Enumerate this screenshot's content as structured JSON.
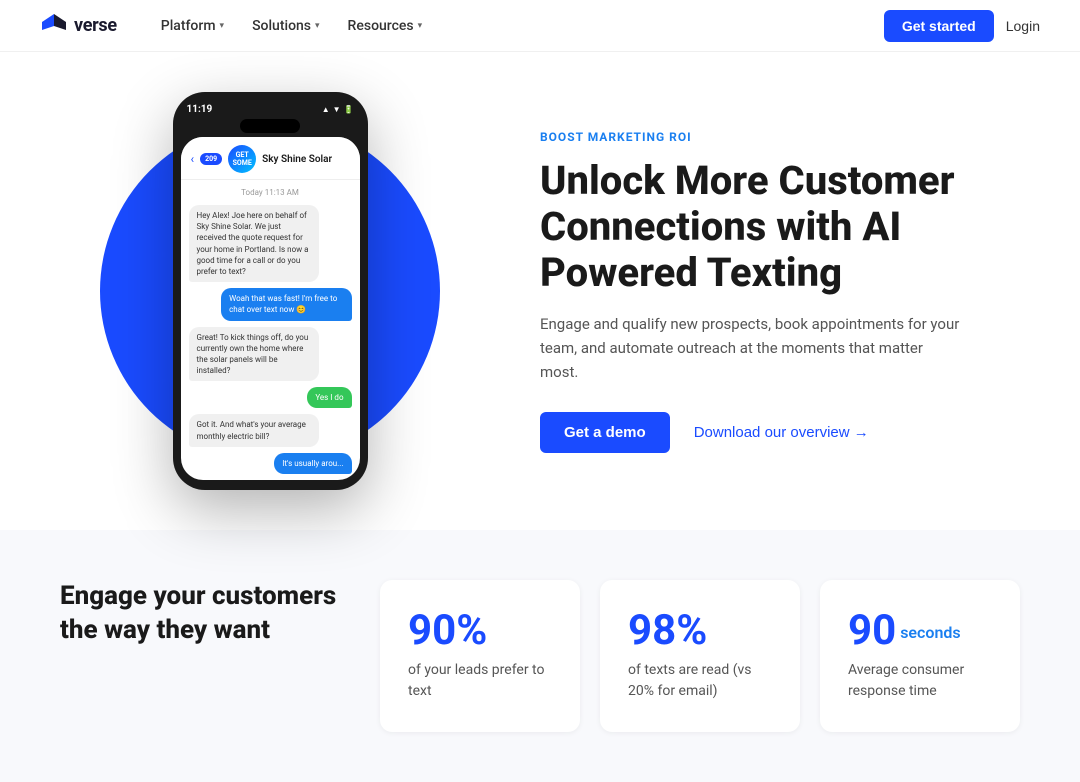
{
  "nav": {
    "logo_text": "verse",
    "items": [
      {
        "label": "Platform",
        "has_dropdown": true
      },
      {
        "label": "Solutions",
        "has_dropdown": true
      },
      {
        "label": "Resources",
        "has_dropdown": true
      }
    ],
    "cta_label": "Get started",
    "login_label": "Login"
  },
  "hero": {
    "phone": {
      "time": "11:19",
      "status": "▲ ▼ 🔋",
      "chat_back": "‹",
      "chat_badge": "209",
      "chat_name": "Sky Shine Solar",
      "date_label": "Today 11:13 AM",
      "messages": [
        {
          "type": "left",
          "text": "Hey Alex! Joe here on behalf of Sky Shine Solar. We just received the quote request for your home in Portland. Is now a good time for a call or do you prefer to text?"
        },
        {
          "type": "right-blue",
          "text": "Woah that was fast! I'm free to chat over text now 😊"
        },
        {
          "type": "left",
          "text": "Great! To kick things off, do you currently own the home where the solar panels will be installed?"
        },
        {
          "type": "right-green",
          "text": "Yes I do"
        },
        {
          "type": "left",
          "text": "Got it. And what's your average monthly electric bill?"
        },
        {
          "type": "right-blue",
          "text": "It's usually arou..."
        }
      ]
    },
    "label": "BOOST MARKETING ROI",
    "title": "Unlock More Customer Connections with AI Powered Texting",
    "description": "Engage and qualify new prospects, book appointments for your team, and automate outreach at the moments that matter most.",
    "cta_primary": "Get a demo",
    "cta_secondary": "Download our overview →"
  },
  "stats": {
    "headline": "Engage your customers the way they want",
    "cards": [
      {
        "number": "90%",
        "description": "of your leads prefer to text"
      },
      {
        "number": "98%",
        "description": "of texts are read (vs 20% for email)"
      },
      {
        "number": "90",
        "suffix": "seconds",
        "description": "Average consumer response time"
      }
    ]
  }
}
